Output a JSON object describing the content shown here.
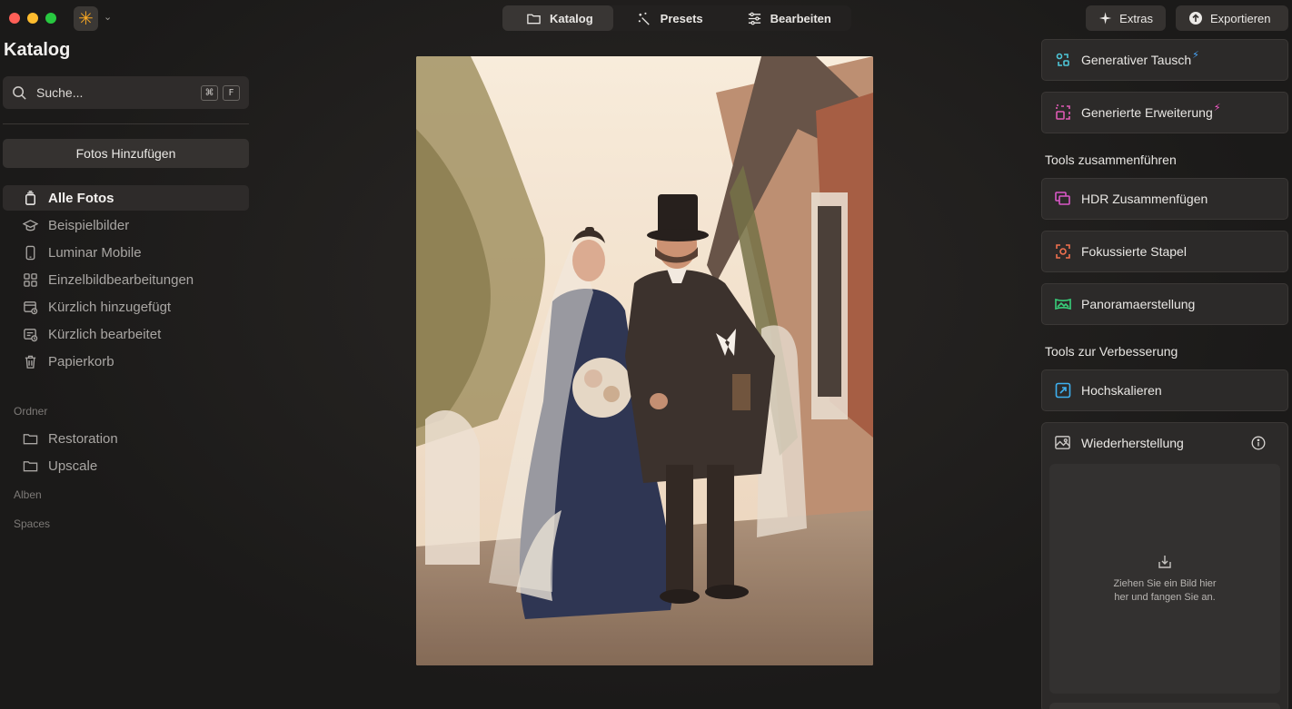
{
  "topbar": {
    "tabs": [
      {
        "label": "Katalog",
        "icon": "folder-icon",
        "active": true
      },
      {
        "label": "Presets",
        "icon": "magic-wand-icon",
        "active": false
      },
      {
        "label": "Bearbeiten",
        "icon": "sliders-icon",
        "active": false
      }
    ],
    "extras_label": "Extras",
    "export_label": "Exportieren"
  },
  "sidebar": {
    "title": "Katalog",
    "search": {
      "placeholder": "Suche...",
      "shortcut_keys": [
        "⌘",
        "F"
      ]
    },
    "add_photos_label": "Fotos Hinzufügen",
    "items": [
      {
        "label": "Alle Fotos",
        "icon": "photo-stack-icon",
        "active": true
      },
      {
        "label": "Beispielbilder",
        "icon": "graduation-cap-icon",
        "active": false
      },
      {
        "label": "Luminar Mobile",
        "icon": "phone-icon",
        "active": false
      },
      {
        "label": "Einzelbildbearbeitungen",
        "icon": "grid-icon",
        "active": false
      },
      {
        "label": "Kürzlich hinzugefügt",
        "icon": "recently-added-icon",
        "active": false
      },
      {
        "label": "Kürzlich bearbeitet",
        "icon": "recently-edited-icon",
        "active": false
      },
      {
        "label": "Papierkorb",
        "icon": "trash-icon",
        "active": false
      }
    ],
    "sections": {
      "folders_label": "Ordner",
      "folders": [
        {
          "label": "Restoration",
          "icon": "folder-icon"
        },
        {
          "label": "Upscale",
          "icon": "folder-icon"
        }
      ],
      "albums_label": "Alben",
      "spaces_label": "Spaces"
    }
  },
  "right_panel": {
    "generative": [
      {
        "label": "Generativer Tausch",
        "icon": "generative-swap-icon",
        "bolt": "⚡"
      },
      {
        "label": "Generierte Erweiterung",
        "icon": "generative-expand-icon",
        "bolt": "⚡"
      }
    ],
    "merge_heading": "Tools zusammenführen",
    "merge_tools": [
      {
        "label": "HDR Zusammenfügen",
        "icon": "hdr-merge-icon"
      },
      {
        "label": "Fokussierte Stapel",
        "icon": "focus-stack-icon"
      },
      {
        "label": "Panoramaerstellung",
        "icon": "panorama-icon"
      }
    ],
    "enhance_heading": "Tools zur Verbesserung",
    "enhance_tools": [
      {
        "label": "Hochskalieren",
        "icon": "upscale-icon"
      }
    ],
    "restoration": {
      "title": "Wiederherstellung",
      "icon": "image-restore-icon",
      "dropzone_text": "Ziehen Sie ein Bild hier her und fangen Sie an."
    }
  },
  "colors": {
    "accent_orange": "#f5a623",
    "bolt_blue": "#49a9ff",
    "bolt_pink": "#ff5ccf"
  }
}
